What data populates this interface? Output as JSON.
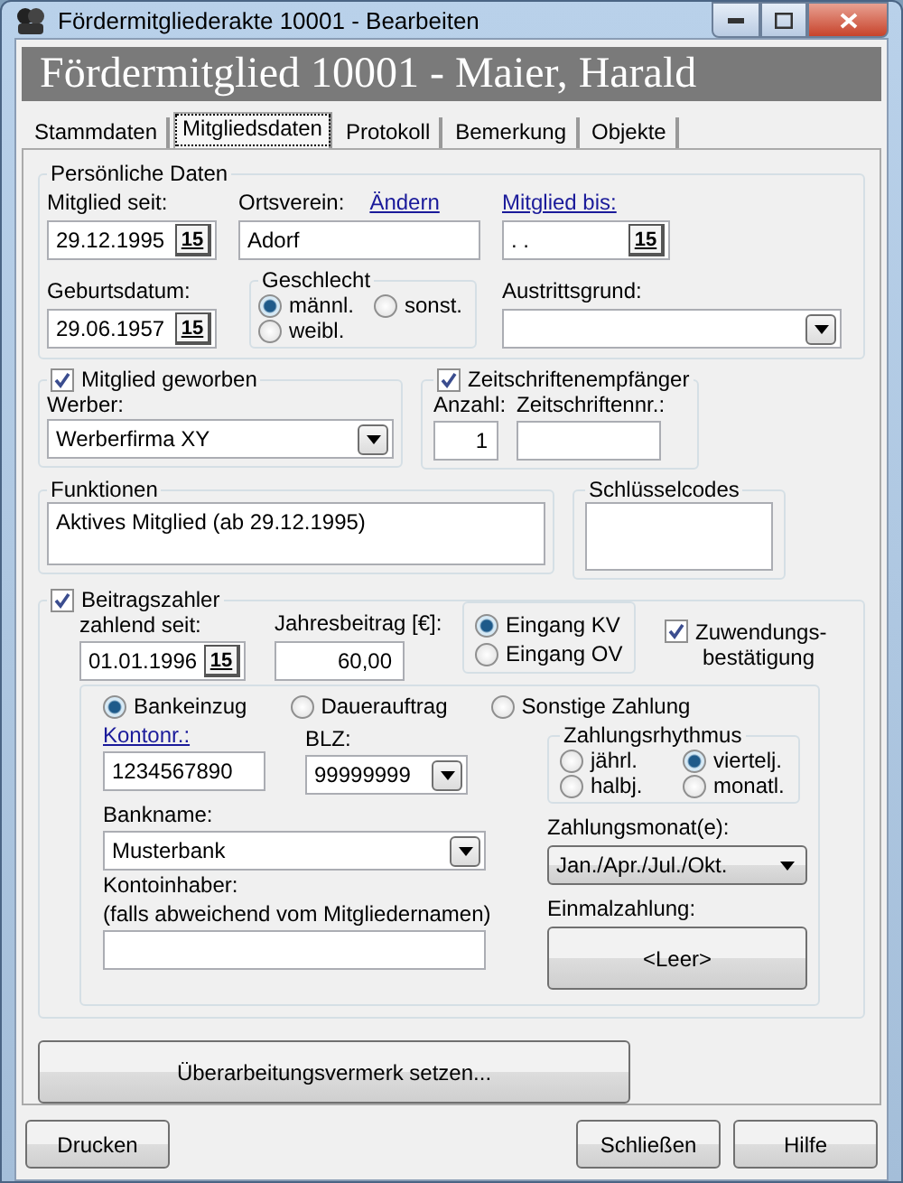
{
  "window": {
    "title": "Fördermitgliederakte 10001 - Bearbeiten"
  },
  "header": "Fördermitglied 10001 - Maier, Harald",
  "tabs": [
    {
      "label": "Stammdaten",
      "selected": false
    },
    {
      "label": "Mitgliedsdaten",
      "selected": true
    },
    {
      "label": "Protokoll",
      "selected": false
    },
    {
      "label": "Bemerkung",
      "selected": false
    },
    {
      "label": "Objekte",
      "selected": false
    }
  ],
  "personal": {
    "title": "Persönliche Daten",
    "member_since": {
      "label": "Mitglied seit:",
      "value": "29.12.1995",
      "button": "15"
    },
    "local_club": {
      "label": "Ortsverein:",
      "link": "Ändern",
      "value": "Adorf"
    },
    "member_until": {
      "label": "Mitglied bis:",
      "value": " .  .",
      "button": "15"
    },
    "birth_date": {
      "label": "Geburtsdatum:",
      "value": "29.06.1957",
      "button": "15"
    },
    "gender": {
      "title": "Geschlecht",
      "options": [
        {
          "label": "männl.",
          "selected": true
        },
        {
          "label": "sonst.",
          "selected": false
        },
        {
          "label": "weibl.",
          "selected": false
        }
      ]
    },
    "exit_reason": {
      "label": "Austrittsgrund:"
    }
  },
  "recruited": {
    "label": "Mitglied geworben",
    "checked": true,
    "recruiter": {
      "label": "Werber:",
      "value": "Werberfirma XY"
    }
  },
  "magazine": {
    "label": "Zeitschriftenempfänger",
    "checked": true,
    "count": {
      "label": "Anzahl:",
      "value": "1"
    },
    "number": {
      "label": "Zeitschriftennr.:"
    }
  },
  "functions": {
    "title": "Funktionen",
    "value": "Aktives Mitglied (ab 29.12.1995)"
  },
  "key_codes": {
    "title": "Schlüsselcodes"
  },
  "payer": {
    "label": "Beitragszahler",
    "checked": true,
    "paying_since": {
      "label": "zahlend seit:",
      "value": "01.01.1996",
      "button": "15"
    },
    "annual_fee": {
      "label": "Jahresbeitrag [€]:",
      "value": "60,00"
    },
    "receipt": [
      {
        "label": "Eingang KV",
        "selected": true
      },
      {
        "label": "Eingang OV",
        "selected": false
      }
    ],
    "donation_receipt": {
      "label": "Zuwendungs-bestätigung",
      "checked": true
    },
    "payment_types": [
      {
        "label": "Bankeinzug",
        "selected": true
      },
      {
        "label": "Dauerauftrag",
        "selected": false
      },
      {
        "label": "Sonstige Zahlung",
        "selected": false
      }
    ],
    "account": {
      "label": "Kontonr.:",
      "value": "1234567890"
    },
    "blz": {
      "label": "BLZ:",
      "value": "99999999"
    },
    "rhythm": {
      "title": "Zahlungsrhythmus",
      "options": [
        {
          "label": "jährl.",
          "selected": false
        },
        {
          "label": "viertelj.",
          "selected": true
        },
        {
          "label": "halbj.",
          "selected": false
        },
        {
          "label": "monatl.",
          "selected": false
        }
      ]
    },
    "bank": {
      "label": "Bankname:",
      "value": "Musterbank"
    },
    "month": {
      "label": "Zahlungsmonat(e):",
      "value": "Jan./Apr./Jul./Okt."
    },
    "holder": {
      "label": "Kontoinhaber:",
      "note": "(falls abweichend vom Mitgliedernamen)"
    },
    "one_time": {
      "label": "Einmalzahlung:",
      "button": "<Leer>"
    }
  },
  "revision_button": "Überarbeitungsvermerk setzen...",
  "buttons": [
    {
      "label": "Drucken"
    },
    {
      "label": "Schließen"
    },
    {
      "label": "Hilfe"
    }
  ]
}
